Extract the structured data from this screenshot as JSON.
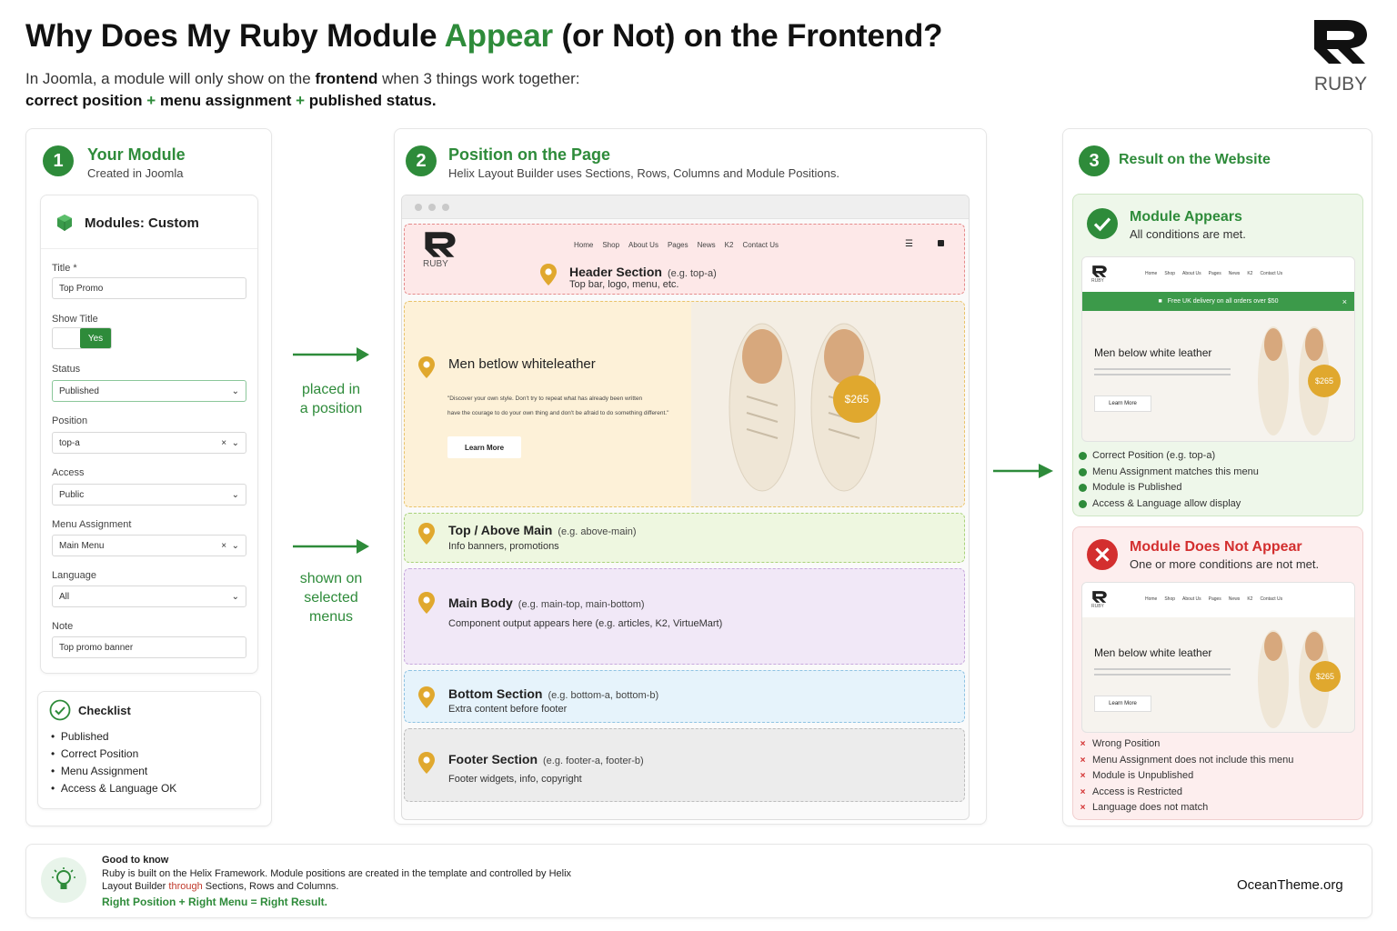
{
  "header": {
    "title_part1": "Why Does My Ruby Module ",
    "title_highlight": "Appear",
    "title_part2": " (or Not) on the Frontend?",
    "subtitle_line1_a": "In Joomla, a module will only show on the ",
    "subtitle_line1_b": "frontend",
    "subtitle_line1_c": " when 3 things work together:",
    "subtitle_line2_a": "correct position",
    "subtitle_line2_plus1": " + ",
    "subtitle_line2_b": "menu assignment",
    "subtitle_line2_plus2": " + ",
    "subtitle_line2_c": "published status."
  },
  "logo": {
    "label": "RUBY"
  },
  "step1": {
    "number": "1",
    "title": "Your Module",
    "subtitle": "Created in Joomla",
    "form_title": "Modules: Custom",
    "fields": {
      "title_label": "Title *",
      "title_value": "Top Promo",
      "show_title_label": "Show Title",
      "show_title_value": "Yes",
      "status_label": "Status",
      "status_value": "Published",
      "position_label": "Position",
      "position_value": "top-a",
      "access_label": "Access",
      "access_value": "Public",
      "menu_label": "Menu Assignment",
      "menu_value": "Main Menu",
      "language_label": "Language",
      "language_value": "All",
      "note_label": "Note",
      "note_value": "Top promo banner"
    },
    "checklist_title": "Checklist",
    "checklist": [
      "Published",
      "Correct Position",
      "Menu Assignment",
      "Access & Language OK"
    ]
  },
  "arrows": {
    "placed_line1": "placed in",
    "placed_line2": "a position",
    "shown_line1": "shown on",
    "shown_line2": "selected",
    "shown_line3": "menus"
  },
  "step2": {
    "number": "2",
    "title": "Position on the Page",
    "subtitle": "Helix Layout Builder uses Sections, Rows, Columns and Module Positions.",
    "nav": [
      "Home",
      "Shop",
      "About Us",
      "Pages",
      "News",
      "K2",
      "Contact Us"
    ],
    "logo_label": "RUBY",
    "header_zone": {
      "title": "Header Section",
      "example": "(e.g. top-a)",
      "desc": "Top bar, logo, menu, etc."
    },
    "hero": {
      "heading": "Men betlow whiteleather",
      "quote_line1": "\"Discover your own style. Don't try to repeat what has already been written",
      "quote_line2": "have the courage to do your own thing and don't be afraid to do something different.\"",
      "button": "Learn More",
      "price": "$265"
    },
    "top_zone": {
      "title": "Top / Above Main",
      "example": "(e.g. above-main)",
      "desc": "Info banners, promotions"
    },
    "main_zone": {
      "title": "Main Body",
      "example": "(e.g. main-top, main-bottom)",
      "desc": "Component output appears here (e.g. articles, K2, VirtueMart)"
    },
    "bottom_zone": {
      "title": "Bottom Section",
      "example": "(e.g. bottom-a, bottom-b)",
      "desc": "Extra content before footer"
    },
    "footer_zone": {
      "title": "Footer Section",
      "example": "(e.g. footer-a, footer-b)",
      "desc": "Footer widgets, info, copyright"
    }
  },
  "step3": {
    "number": "3",
    "title": "Result on the Website",
    "appears": {
      "title": "Module Appears",
      "subtitle": "All conditions are met.",
      "banner": "Free UK delivery on all orders over $50",
      "heading": "Men below white leather",
      "button": "Learn More",
      "price": "$265",
      "checks": [
        "Correct Position (e.g. top-a)",
        "Menu Assignment matches this menu",
        "Module is Published",
        "Access & Language allow display"
      ]
    },
    "not_appear": {
      "title": "Module Does Not Appear",
      "subtitle": "One or more conditions are not met.",
      "heading": "Men below white leather",
      "button": "Learn More",
      "price": "$265",
      "issues": [
        "Wrong Position",
        "Menu Assignment does not include this menu",
        "Module is Unpublished",
        "Access is Restricted",
        "Language does not match"
      ]
    },
    "mini_nav": [
      "Home",
      "Shop",
      "About Us",
      "Pages",
      "News",
      "K2",
      "Contact Us"
    ],
    "mini_logo": "RUBY"
  },
  "footer": {
    "title": "Good to know",
    "line1": "Ruby is built on the Helix Framework. Module positions are created in the template and controlled by Helix",
    "line2_a": "Layout Builder ",
    "line2_b": "through",
    "line2_c": " Sections, Rows and Columns.",
    "tagline": "Right Position + Right Menu = Right Result.",
    "brand": "OceanTheme.org"
  },
  "colors": {
    "accent": "#2e8b3a",
    "error": "#d32f2f",
    "pin": "#e0a82e",
    "header_zone": "#fde8e8",
    "hero_zone": "#fdf1d8",
    "top_zone": "#eef7e0",
    "main_zone": "#f1e8f7",
    "bottom_zone": "#e6f3fb",
    "footer_zone": "#ececec"
  }
}
